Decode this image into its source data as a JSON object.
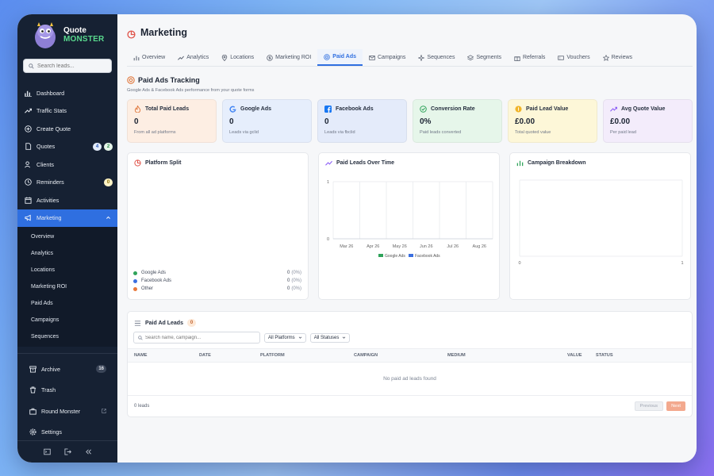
{
  "brand": {
    "line1": "Quote",
    "line2": "MONSTER"
  },
  "sidebar": {
    "search_placeholder": "Search leads...",
    "items": [
      {
        "label": "Dashboard",
        "icon": "bar-chart-icon"
      },
      {
        "label": "Traffic Stats",
        "icon": "trending-icon"
      },
      {
        "label": "Create Quote",
        "icon": "plus-circle-icon"
      },
      {
        "label": "Quotes",
        "icon": "document-icon",
        "badge1": "4",
        "badge2": "2"
      },
      {
        "label": "Clients",
        "icon": "users-icon"
      },
      {
        "label": "Reminders",
        "icon": "clock-icon",
        "badge": "0"
      },
      {
        "label": "Activities",
        "icon": "calendar-icon"
      },
      {
        "label": "Marketing",
        "icon": "megaphone-icon",
        "active": true
      }
    ],
    "marketing_sub": [
      "Overview",
      "Analytics",
      "Locations",
      "Marketing ROI",
      "Paid Ads",
      "Campaigns",
      "Sequences"
    ],
    "bottom": [
      {
        "label": "Archive",
        "badge": "16"
      },
      {
        "label": "Trash"
      },
      {
        "label": "Round Monster"
      },
      {
        "label": "Settings"
      }
    ]
  },
  "page": {
    "title": "Marketing"
  },
  "tabs": [
    "Overview",
    "Analytics",
    "Locations",
    "Marketing ROI",
    "Paid Ads",
    "Campaigns",
    "Sequences",
    "Segments",
    "Referrals",
    "Vouchers",
    "Reviews"
  ],
  "active_tab": "Paid Ads",
  "section": {
    "title": "Paid Ads Tracking",
    "subtitle": "Google Ads & Facebook Ads performance from your quote forms"
  },
  "cards": [
    {
      "title": "Total Paid Leads",
      "value": "0",
      "sub": "From all ad platforms",
      "bg": "#fdeee3",
      "icon": "fire-icon",
      "accent": "#e0763a"
    },
    {
      "title": "Google Ads",
      "value": "0",
      "sub": "Leads via gclid",
      "bg": "#e6eefc",
      "icon": "google-icon",
      "accent": "#4285f4"
    },
    {
      "title": "Facebook Ads",
      "value": "0",
      "sub": "Leads via fbclid",
      "bg": "#e4ebfa",
      "icon": "facebook-icon",
      "accent": "#1877f2"
    },
    {
      "title": "Conversion Rate",
      "value": "0%",
      "sub": "Paid leads converted",
      "bg": "#e6f6ea",
      "icon": "check-circle-icon",
      "accent": "#2fa35a"
    },
    {
      "title": "Paid Lead Value",
      "value": "£0.00",
      "sub": "Total quoted value",
      "bg": "#fdf7d8",
      "icon": "coin-icon",
      "accent": "#d9a514"
    },
    {
      "title": "Avg Quote Value",
      "value": "£0.00",
      "sub": "Per paid lead",
      "bg": "#f3ecfb",
      "icon": "trend-up-icon",
      "accent": "#8b5cf6"
    }
  ],
  "platform_split": {
    "title": "Platform Split",
    "rows": [
      {
        "name": "Google Ads",
        "value": "0",
        "pct": "(0%)",
        "color": "#2fa35a"
      },
      {
        "name": "Facebook Ads",
        "value": "0",
        "pct": "(0%)",
        "color": "#3b6fe0"
      },
      {
        "name": "Other",
        "value": "0",
        "pct": "(0%)",
        "color": "#e9783a"
      }
    ]
  },
  "chart_data": [
    {
      "type": "line",
      "title": "Paid Leads Over Time",
      "categories": [
        "Mar 26",
        "Apr 26",
        "May 26",
        "Jun 26",
        "Jul 26",
        "Aug 26"
      ],
      "series": [
        {
          "name": "Google Ads",
          "values": [
            0,
            0,
            0,
            0,
            0,
            0
          ],
          "color": "#2fa35a"
        },
        {
          "name": "Facebook Ads",
          "values": [
            0,
            0,
            0,
            0,
            0,
            0
          ],
          "color": "#3b6fe0"
        }
      ],
      "ylim": [
        0,
        1
      ],
      "yticks": [
        "0",
        "1"
      ],
      "legend": "bottom",
      "grid": true
    },
    {
      "type": "bar",
      "title": "Campaign Breakdown",
      "categories": [],
      "values": [],
      "xlim": [
        0,
        1
      ],
      "xticks": [
        "0",
        "1"
      ],
      "grid": true
    }
  ],
  "leads_table": {
    "title": "Paid Ad Leads",
    "count_badge": "0",
    "search_placeholder": "Search name, campaign...",
    "platform_filter": "All Platforms",
    "status_filter": "All Statuses",
    "columns": [
      "NAME",
      "DATE",
      "PLATFORM",
      "CAMPAIGN",
      "MEDIUM",
      "VALUE",
      "STATUS"
    ],
    "empty_text": "No paid ad leads found",
    "footer_count": "0 leads",
    "prev_label": "Previous",
    "next_label": "Next"
  }
}
